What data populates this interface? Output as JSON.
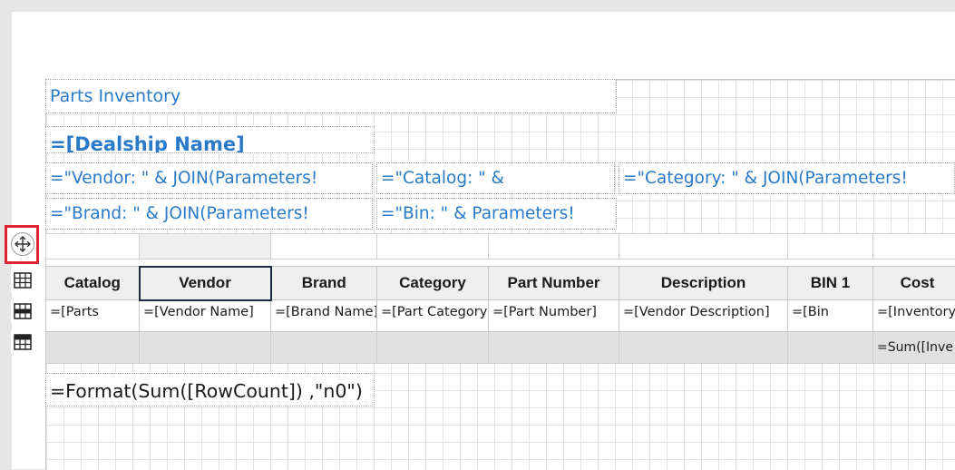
{
  "report": {
    "title": "Parts Inventory",
    "dealship_expr": "=[Dealship Name]",
    "vendor_param": "=\"Vendor: \" & JOIN(Parameters!",
    "catalog_param": "=\"Catalog: \" &",
    "category_param": "=\"Category: \" & JOIN(Parameters!",
    "brand_param": "=\"Brand: \" & JOIN(Parameters!",
    "bin_param": "=\"Bin: \" & Parameters!",
    "rowcount_expr": "=Format(Sum([RowCount]) ,\"n0\")"
  },
  "table": {
    "headers": [
      "Catalog",
      "Vendor",
      "Brand",
      "Category",
      "Part Number",
      "Description",
      "BIN 1",
      "Cost"
    ],
    "detail": [
      "=[Parts",
      "=[Vendor Name]",
      "=[Brand Name]",
      "=[Part Category]",
      "=[Part Number]",
      "=[Vendor Description]",
      "=[Bin",
      "=[Inventory"
    ],
    "totals": [
      "",
      "",
      "",
      "",
      "",
      "",
      "",
      "=Sum([Inve"
    ],
    "selected_column": "Vendor"
  },
  "handles": {
    "move_icon": "move-arrows-icon",
    "select_table_icon": "table-select-icon",
    "select_row_icon": "table-row-icon",
    "select_column_icon": "table-column-icon",
    "highlight_color": "#e0262a"
  }
}
